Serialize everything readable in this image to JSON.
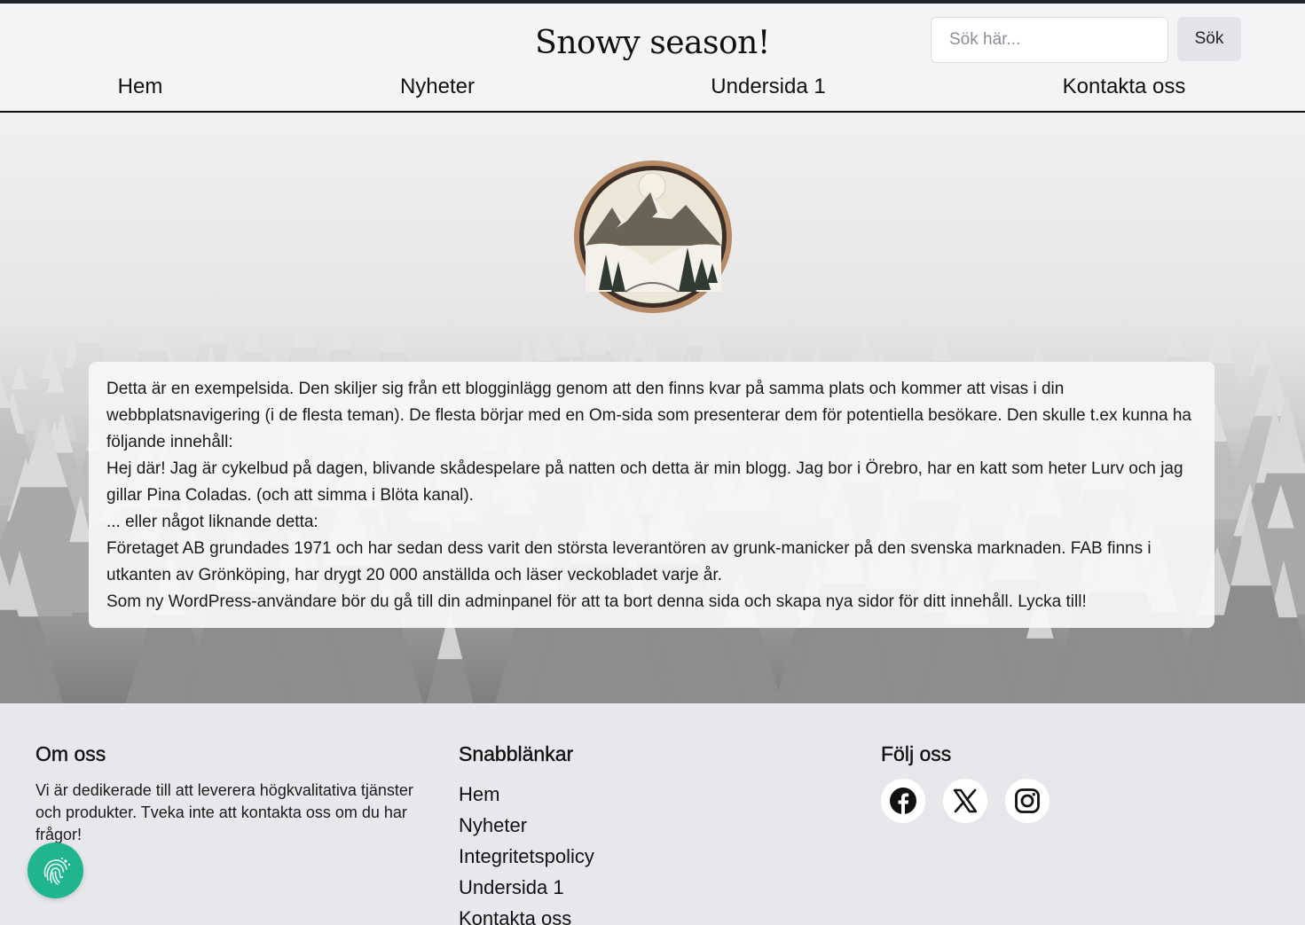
{
  "header": {
    "site_title": "Snowy season!",
    "search": {
      "placeholder": "Sök här...",
      "button_label": "Sök"
    },
    "nav": [
      {
        "label": "Hem"
      },
      {
        "label": "Nyheter"
      },
      {
        "label": "Undersida 1"
      },
      {
        "label": "Kontakta oss"
      }
    ]
  },
  "main": {
    "paragraphs": [
      "Detta är en exempelsida. Den skiljer sig från ett blogginlägg genom att den finns kvar på samma plats och kommer att visas i din webbplatsnavigering (i de flesta teman). De flesta börjar med en Om-sida som presenterar dem för potentiella besökare. Den skulle t.ex kunna ha följande innehåll:",
      "Hej där! Jag är cykelbud på dagen, blivande skådespelare på natten och detta är min blogg. Jag bor i Örebro, har en katt som heter Lurv och jag gillar Pina Coladas. (och att simma i Blöta kanal).",
      "... eller något liknande detta:",
      "Företaget AB grundades 1971 och har sedan dess varit den största leverantören av grunk-manicker på den svenska marknaden. FAB finns i utkanten av Grönköping, har drygt 20 000 anställda och läser veckobladet varje år.",
      "Som ny WordPress-användare bör du gå till din adminpanel för att ta bort denna sida och skapa nya sidor för ditt innehåll. Lycka till!"
    ]
  },
  "footer": {
    "about": {
      "heading": "Om oss",
      "text": "Vi är dedikerade till att leverera högkvalitativa tjänster och produkter. Tveka inte att kontakta oss om du har frågor!"
    },
    "quick_links": {
      "heading": "Snabblänkar",
      "items": [
        {
          "label": "Hem"
        },
        {
          "label": "Nyheter"
        },
        {
          "label": "Integritetspolicy"
        },
        {
          "label": "Undersida 1"
        },
        {
          "label": "Kontakta oss"
        }
      ]
    },
    "follow": {
      "heading": "Följ oss",
      "icons": [
        "facebook-icon",
        "x-icon",
        "instagram-icon"
      ]
    }
  },
  "widget": {
    "icon": "fingerprint-icon",
    "color": "#1fb58f"
  },
  "colors": {
    "header_bg": "#f3f4f6",
    "footer_bg": "#e7e8eb",
    "accent": "#1fb58f"
  }
}
